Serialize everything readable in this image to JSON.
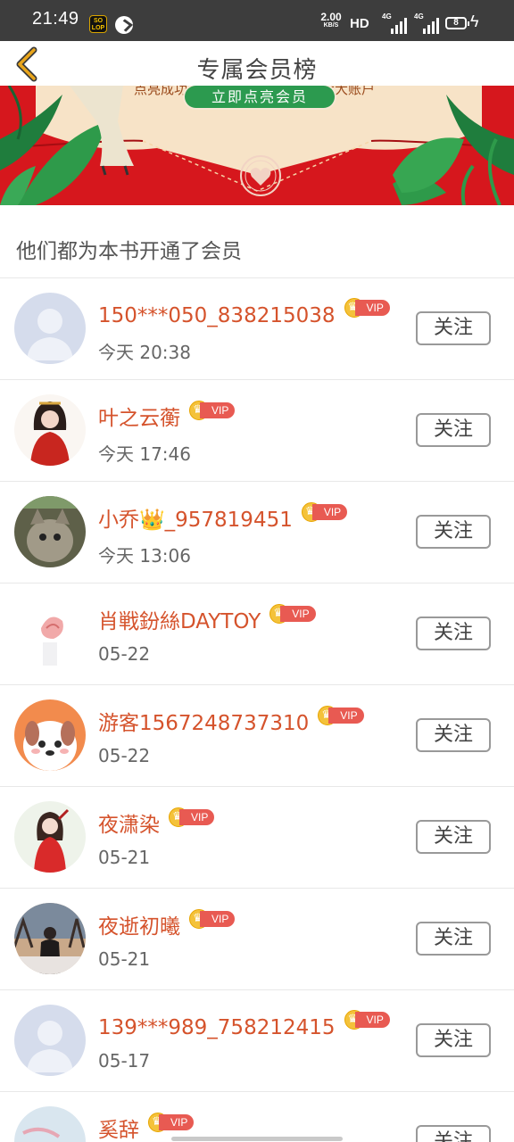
{
  "status_bar": {
    "time": "21:49",
    "app_icon_1_text": "SO LOP",
    "net_speed_value": "2.00",
    "net_speed_unit": "KB/S",
    "hd_label": "HD",
    "signal_1_label": "4G",
    "signal_2_label": "4G",
    "battery_level": "8",
    "icons": [
      "app-icon",
      "browser-icon",
      "signal-icon",
      "signal-icon",
      "battery-icon",
      "charging-icon"
    ]
  },
  "header": {
    "title": "专属会员榜",
    "back_icon": "chevron-left-icon",
    "accent_color": "#e9a51a"
  },
  "banner": {
    "partial_text": "点亮成功，收益立刻同步到作者大大账户",
    "button_label": "立即点亮会员",
    "bg_color": "#d6171d",
    "button_color": "#2c9a4f"
  },
  "section": {
    "title": "他们都为本书开通了会员"
  },
  "vip_badge_label": "VIP",
  "follow_label": "关注",
  "members": [
    {
      "name": "150***050_838215038",
      "time": "今天 20:38",
      "avatar": "default-avatar"
    },
    {
      "name": "叶之云蘅",
      "time": "今天 17:46",
      "avatar": "girl-avatar"
    },
    {
      "name": "小乔👑_957819451",
      "time": "今天 13:06",
      "avatar": "cat-avatar"
    },
    {
      "name": "肖戦鈖絲DAYTOY",
      "time": "05-22",
      "avatar": "flower-avatar"
    },
    {
      "name": "游客1567248737310",
      "time": "05-22",
      "avatar": "dog-avatar"
    },
    {
      "name": "夜潇染",
      "time": "05-21",
      "avatar": "girl-avatar"
    },
    {
      "name": "夜逝初曦",
      "time": "05-21",
      "avatar": "person-avatar"
    },
    {
      "name": "139***989_758212415",
      "time": "05-17",
      "avatar": "default-avatar"
    },
    {
      "name": "奚辞",
      "time": "",
      "avatar": "landscape-avatar"
    }
  ]
}
